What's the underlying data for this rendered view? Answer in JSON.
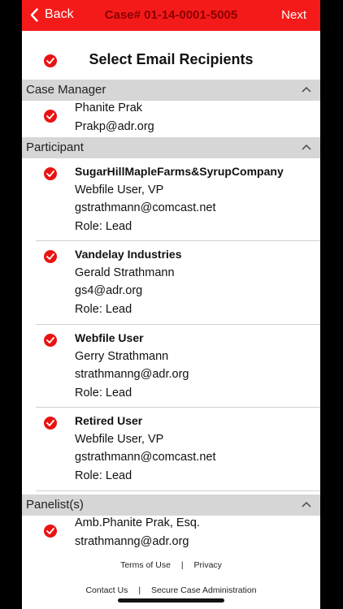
{
  "nav": {
    "back_label": "Back",
    "title": "Case# 01-14-0001-5005",
    "next_label": "Next"
  },
  "header": {
    "title": "Select Email Recipients"
  },
  "sections": {
    "case_manager": {
      "label": "Case Manager",
      "entries": [
        {
          "lines": [
            "Phanite Prak",
            "Prakp@adr.org"
          ]
        }
      ]
    },
    "participant": {
      "label": "Participant",
      "entries": [
        {
          "name": "SugarHillMapleFarms&SyrupCompany",
          "lines": [
            "Webfile User, VP",
            "gstrathmann@comcast.net",
            "Role: Lead"
          ]
        },
        {
          "name": "Vandelay Industries",
          "lines": [
            "Gerald Strathmann",
            "gs4@adr.org",
            "Role: Lead"
          ]
        },
        {
          "name": "Webfile User",
          "lines": [
            "Gerry Strathmann",
            "strathmanng@adr.org",
            "Role: Lead"
          ]
        },
        {
          "name": "Retired User",
          "lines": [
            "Webfile User, VP",
            "gstrathmann@comcast.net",
            "Role: Lead"
          ]
        }
      ]
    },
    "panelists": {
      "label": "Panelist(s)",
      "entries": [
        {
          "lines": [
            "Amb.Phanite Prak, Esq.",
            "strathmanng@adr.org"
          ]
        }
      ]
    }
  },
  "footer": {
    "terms": "Terms of Use",
    "privacy": "Privacy",
    "contact": "Contact Us",
    "secure": "Secure Case Administration",
    "divider": "|"
  },
  "colors": {
    "accent": "#f51a1a",
    "check": "#ea1313",
    "section_bar": "#d6d6d6"
  }
}
